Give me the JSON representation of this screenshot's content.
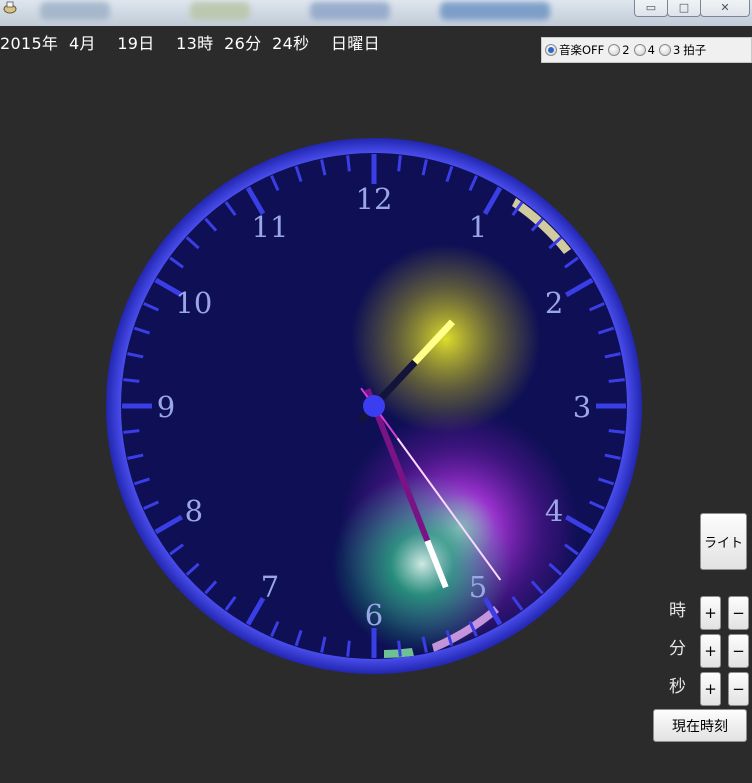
{
  "window": {
    "minimize_glyph": "▭",
    "maximize_glyph": "□",
    "close_glyph": "✕"
  },
  "datetime_text": "2015年  4月    19日    13時  26分  24秒    日曜日",
  "music": {
    "options": [
      {
        "label": "音楽OFF",
        "selected": true
      },
      {
        "label": "2",
        "selected": false
      },
      {
        "label": "4",
        "selected": false
      },
      {
        "label": "3",
        "selected": false
      }
    ],
    "suffix": "拍子"
  },
  "clock": {
    "numbers": [
      "12",
      "1",
      "2",
      "3",
      "4",
      "5",
      "6",
      "7",
      "8",
      "9",
      "10",
      "11"
    ],
    "time": {
      "hour": 13,
      "minute": 26,
      "second": 24
    },
    "colors": {
      "face": "#0e0f55",
      "rim": "#3a3ee6",
      "numerals": "#9aa6e8",
      "hour_glow": "#e6e62a",
      "minute_glow": "#1fb37a",
      "second_glow": "#b12ee0"
    }
  },
  "controls": {
    "light_label": "ライト",
    "units": [
      {
        "label": "時",
        "plus": "+",
        "minus": "−"
      },
      {
        "label": "分",
        "plus": "+",
        "minus": "−"
      },
      {
        "label": "秒",
        "plus": "+",
        "minus": "−"
      }
    ],
    "now_label": "現在時刻"
  }
}
